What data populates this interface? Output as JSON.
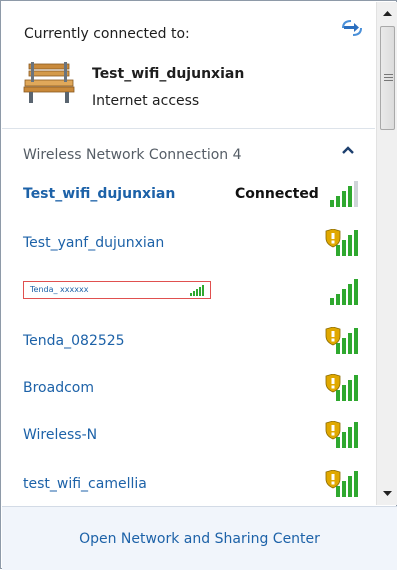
{
  "current": {
    "header": "Currently connected to:",
    "network_name": "Test_wifi_dujunxian",
    "status": "Internet access"
  },
  "section": {
    "title": "Wireless Network Connection 4"
  },
  "networks": [
    {
      "name": "Test_wifi_dujunxian",
      "status": "Connected",
      "secured": false,
      "bold": true
    },
    {
      "name": "Test_yanf_dujunxian",
      "status": "",
      "secured": true
    },
    {
      "name": "Tenda_ xxxxxx",
      "status": "",
      "secured": false,
      "redacted_box": true
    },
    {
      "name": "Tenda_082525",
      "status": "",
      "secured": true
    },
    {
      "name": "Broadcom",
      "status": "",
      "secured": true
    },
    {
      "name": "Wireless-N",
      "status": "",
      "secured": true
    },
    {
      "name": "test_wifi_camellia",
      "status": "",
      "secured": true
    }
  ],
  "footer": {
    "link": "Open Network and Sharing Center"
  },
  "colors": {
    "link": "#1d62a8",
    "signal": "#2fa82f",
    "shield": "#e0a800"
  }
}
